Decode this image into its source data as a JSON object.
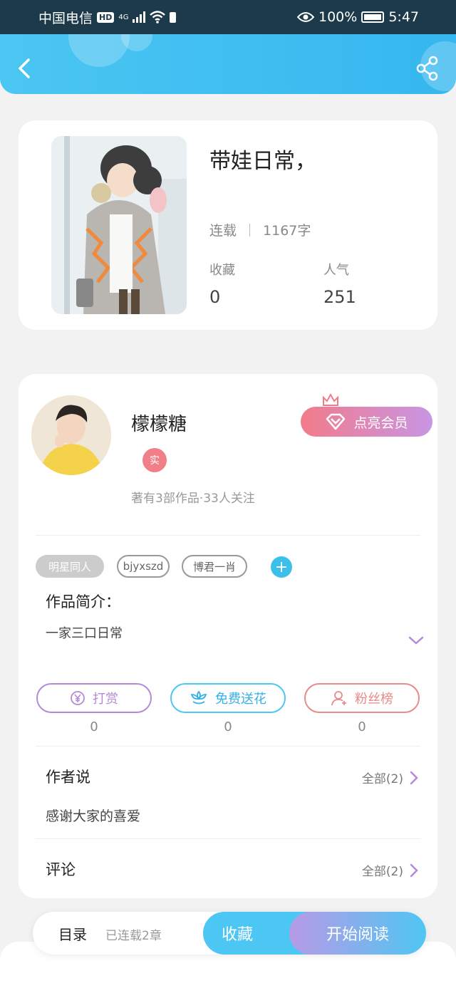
{
  "status_bar": {
    "carrier": "中国电信",
    "hd": "HD",
    "network": "4G",
    "battery": "100%",
    "time": "5:47"
  },
  "icons": {
    "back": "chevron-left-icon",
    "share": "share-icon",
    "vip": "diamond-icon",
    "reward": "yen-icon",
    "flower": "flower-icon",
    "fans": "person-icon"
  },
  "book": {
    "title": "带娃日常，",
    "status": "连载",
    "word_count": "1167字",
    "favorites_label": "收藏",
    "favorites_value": "0",
    "popularity_label": "人气",
    "popularity_value": "251"
  },
  "author": {
    "name": "檬檬糖",
    "verified_badge": "实",
    "meta": "著有3部作品·33人关注",
    "vip_button": "点亮会员"
  },
  "tags": [
    "明星同人",
    "bjyxszd",
    "博君一肖"
  ],
  "tag_add": "+",
  "intro": {
    "title": "作品简介：",
    "text": "一家三口日常"
  },
  "actions": [
    {
      "label": "打赏",
      "count": "0"
    },
    {
      "label": "免费送花",
      "count": "0"
    },
    {
      "label": "粉丝榜",
      "count": "0"
    }
  ],
  "author_says": {
    "title": "作者说",
    "link": "全部(2)",
    "text": "感谢大家的喜爱"
  },
  "comments": {
    "title": "评论",
    "link": "全部(2)"
  },
  "bottom_bar": {
    "toc": "目录",
    "toc_status": "已连载2章",
    "favorite": "收藏",
    "start_reading": "开始阅读"
  },
  "colors": {
    "accent_blue": "#4cc6f2",
    "vip_pink": "#f27b8a",
    "vip_purple": "#c895e4",
    "reward_purple": "#b48ad8",
    "flower_blue": "#4cc6f2",
    "fans_red": "#e88a8a"
  }
}
